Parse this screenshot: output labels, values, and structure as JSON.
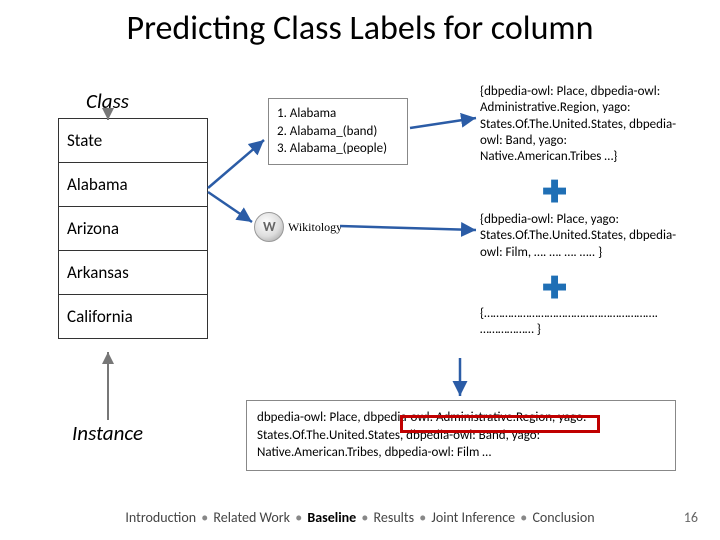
{
  "title": "Predicting Class Labels for column",
  "class_label": "Class",
  "instance_label": "Instance",
  "table": {
    "header": "State",
    "rows": [
      "Alabama",
      "Arizona",
      "Arkansas",
      "California"
    ]
  },
  "disambiguation": {
    "lines": [
      "1. Alabama",
      "2. Alabama_(band)",
      "3. Alabama_(people)"
    ]
  },
  "wikitology_label": "Wikitology",
  "annotations": {
    "a1": "{dbpedia-owl: Place, dbpedia-owl: Administrative.Region, yago: States.Of.The.United.States, dbpedia-owl: Band, yago: Native.American.Tribes …}",
    "a2": "{dbpedia-owl: Place, yago: States.Of.The.United.States, dbpedia-owl: Film, …. …. …. ….. }",
    "a3": "{…………………………………………………. ……………… }"
  },
  "result_text": "dbpedia-owl: Place, dbpedia-owl: Administrative.Region, yago: States.Of.The.United.States, dbpedia-owl: Band, yago: Native.American.Tribes, dbpedia-owl: Film …",
  "footer": {
    "items": [
      "Introduction",
      "Related Work",
      "Baseline",
      "Results",
      "Joint Inference",
      "Conclusion"
    ],
    "bold_index": 2
  },
  "page_number": "16"
}
